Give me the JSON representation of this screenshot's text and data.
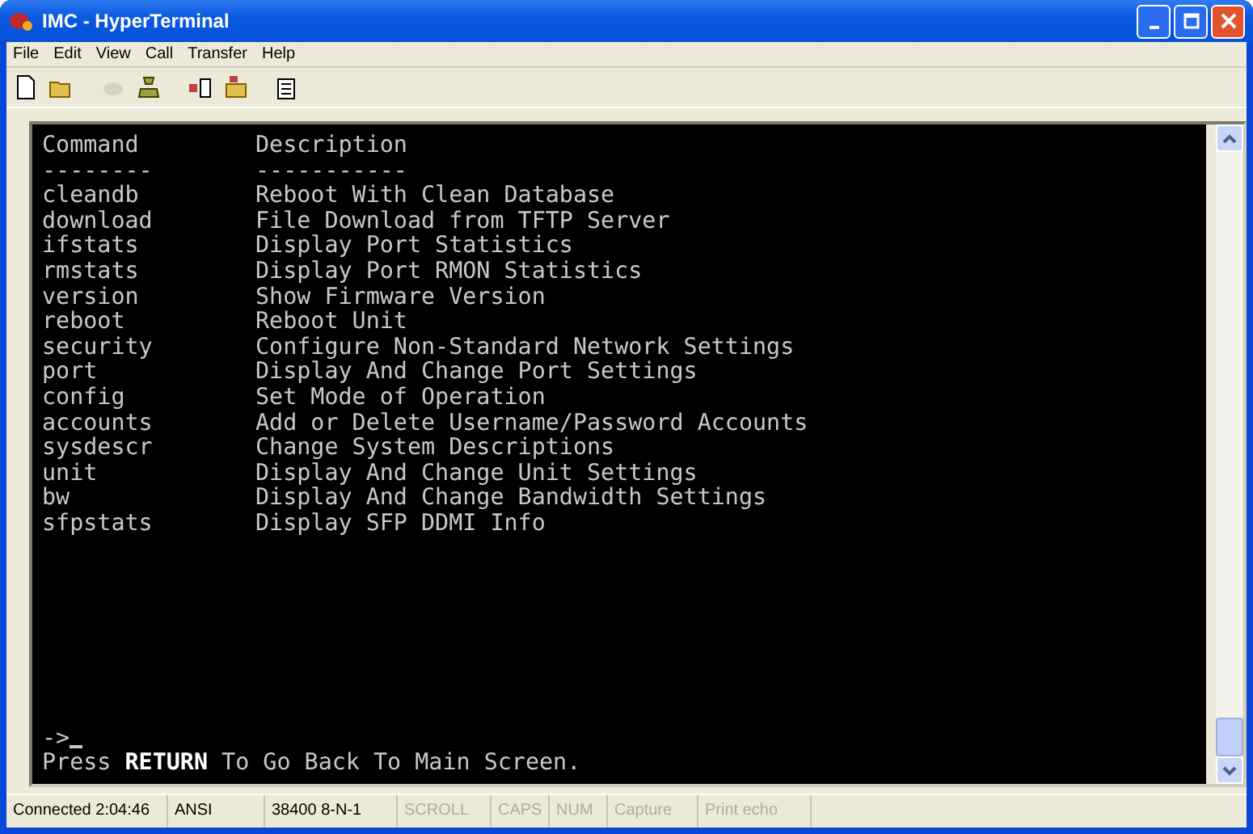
{
  "window": {
    "title": "IMC - HyperTerminal"
  },
  "menu": [
    "File",
    "Edit",
    "View",
    "Call",
    "Transfer",
    "Help"
  ],
  "toolbar": [
    {
      "kind": "new",
      "disabled": false
    },
    {
      "kind": "open",
      "disabled": false
    },
    {
      "kind": "disconnect",
      "disabled": true
    },
    {
      "kind": "dial",
      "disabled": false
    },
    {
      "kind": "send",
      "disabled": false
    },
    {
      "kind": "receive",
      "disabled": false
    },
    {
      "kind": "properties",
      "disabled": false
    }
  ],
  "terminal": {
    "header": [
      "Command",
      "Description"
    ],
    "underline": [
      "--------",
      "-----------"
    ],
    "rows": [
      [
        "cleandb",
        "Reboot With Clean Database"
      ],
      [
        "download",
        "File Download from TFTP Server"
      ],
      [
        "ifstats",
        "Display Port Statistics"
      ],
      [
        "rmstats",
        "Display Port RMON Statistics"
      ],
      [
        "version",
        "Show Firmware Version"
      ],
      [
        "reboot",
        "Reboot Unit"
      ],
      [
        "security",
        "Configure Non-Standard Network Settings"
      ],
      [
        "port",
        "Display And Change Port Settings"
      ],
      [
        "config",
        "Set Mode of Operation"
      ],
      [
        "accounts",
        "Add or Delete Username/Password Accounts"
      ],
      [
        "sysdescr",
        "Change System Descriptions"
      ],
      [
        "unit",
        "Display And Change Unit Settings"
      ],
      [
        "bw",
        "Display And Change Bandwidth Settings"
      ],
      [
        "sfpstats",
        "Display SFP DDMI Info"
      ]
    ],
    "prompt": "->",
    "footer": "Press **RETURN** To Go Back To Main Screen."
  },
  "status_bar": [
    {
      "text": "Connected 2:04:46",
      "disabled": false
    },
    {
      "text": "ANSI",
      "disabled": false
    },
    {
      "text": "38400 8-N-1",
      "disabled": false
    },
    {
      "text": "SCROLL",
      "disabled": true
    },
    {
      "text": "CAPS",
      "disabled": true
    },
    {
      "text": "NUM",
      "disabled": true
    },
    {
      "text": "Capture",
      "disabled": true
    },
    {
      "text": "Print echo",
      "disabled": true
    }
  ]
}
